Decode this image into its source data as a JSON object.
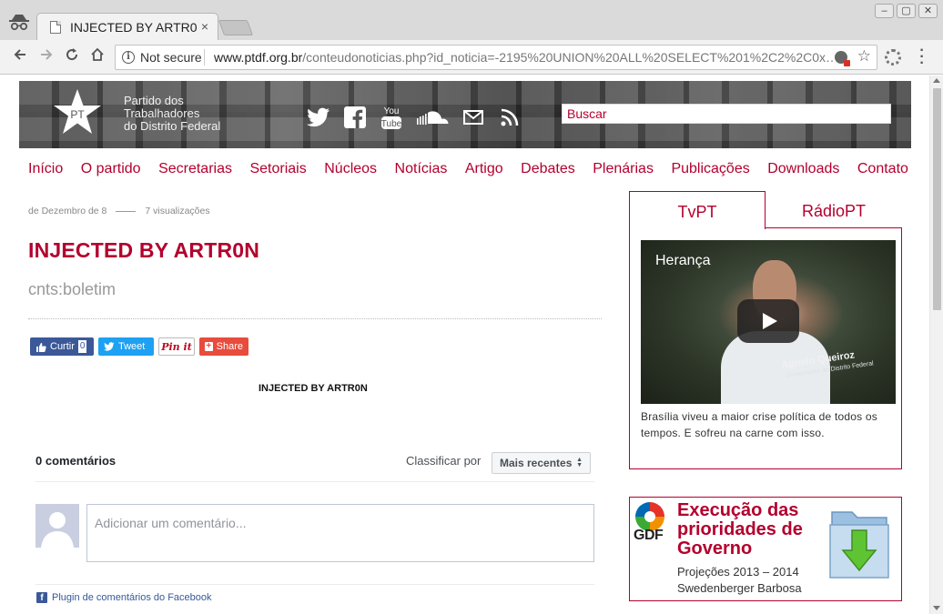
{
  "browser": {
    "tab_title": "INJECTED BY ARTR0N",
    "tab_close": "×",
    "security_label": "Not secure",
    "url_domain": "www.ptdf.org.br",
    "url_path": "/conteudonoticias.php?id_noticia=-2195%20UNION%20ALL%20SELECT%201%2C2%2C0x…",
    "window_buttons": [
      "–",
      "▢",
      "✕"
    ]
  },
  "site": {
    "logo_letters": "PT",
    "logo_text": [
      "Partido dos",
      "Trabalhadores",
      "do Distrito Federal"
    ],
    "social_icons": [
      "twitter-icon",
      "facebook-icon",
      "youtube-icon",
      "soundcloud-icon",
      "email-icon",
      "rss-icon"
    ],
    "search_placeholder": "Buscar",
    "nav": [
      "Início",
      "O partido",
      "Secretarias",
      "Setoriais",
      "Núcleos",
      "Notícias",
      "Artigo",
      "Debates",
      "Plenárias",
      "Publicações",
      "Downloads",
      "Contato"
    ]
  },
  "article": {
    "date": "de Dezembro de 8",
    "views": "7 visualizações",
    "title": "INJECTED BY ARTR0N",
    "subtitle": "cnts:boletim",
    "body": "INJECTED BY ARTR0N"
  },
  "share": {
    "facebook_label": "Curtir",
    "facebook_count": "0",
    "twitter_label": "Tweet",
    "pinterest_label": "Pin it",
    "share_label": "Share"
  },
  "comments": {
    "count_label": "0 comentários",
    "sort_label": "Classificar por",
    "sort_value": "Mais recentes",
    "placeholder": "Adicionar um comentário...",
    "plugin_label": "Plugin de comentários do Facebook"
  },
  "sidebar": {
    "tabs": [
      "TvPT",
      "RádioPT"
    ],
    "video_title": "Herança",
    "video_person": "Agnelo Queiroz",
    "video_role": "Governador do Distrito Federal",
    "video_desc": "Brasília viveu a maior crise política de todos os tempos. E sofreu na carne com isso.",
    "banner_logo": "GDF",
    "banner_title": "Execução das prioridades de Governo",
    "banner_lines": [
      "Projeções 2013 – 2014",
      "Swedenberger Barbosa"
    ]
  },
  "colors": {
    "accent": "#b3002d",
    "facebook": "#3b5998",
    "twitter": "#1da1f2"
  }
}
